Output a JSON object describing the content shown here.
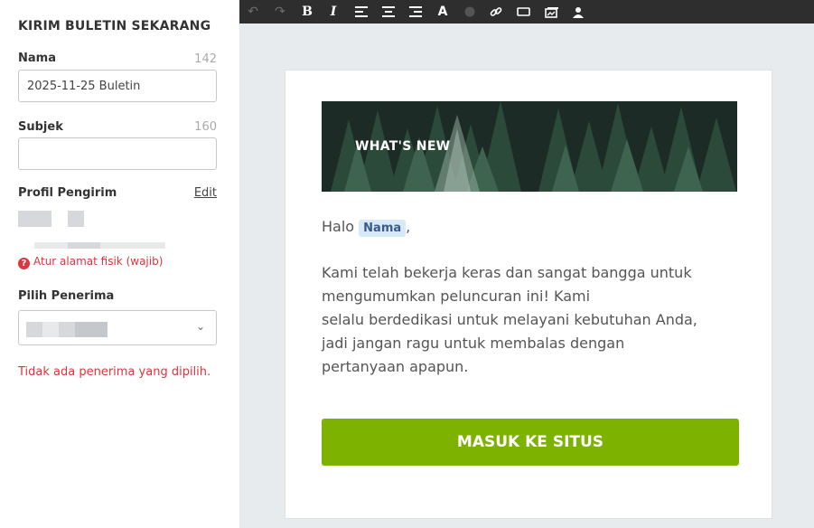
{
  "panel": {
    "title": "KIRIM BULETIN SEKARANG",
    "name_label": "Nama",
    "name_counter": "142",
    "name_value": "2025-11-25 Buletin",
    "subject_label": "Subjek",
    "subject_counter": "160",
    "subject_value": "",
    "sender_label": "Profil Pengirim",
    "edit_label": "Edit",
    "warning_text": "Atur alamat fisik (wajib)",
    "recipient_label": "Pilih Penerima",
    "recipient_error": "Tidak ada penerima yang dipilih."
  },
  "toolbar": {
    "buttons": [
      "undo",
      "redo",
      "bold",
      "italic",
      "align-left",
      "align-center",
      "align-right",
      "font-color",
      "circle",
      "link",
      "button",
      "image",
      "person"
    ]
  },
  "email": {
    "hero_text": "WHAT'S NEW",
    "greeting_prefix": "Halo",
    "greeting_token": "Nama",
    "greeting_suffix": ",",
    "body_lines": [
      "Kami telah bekerja keras dan sangat bangga untuk",
      "mengumumkan peluncuran ini! Kami",
      "selalu berdedikasi untuk melayani kebutuhan Anda,",
      "jadi jangan ragu untuk membalas dengan",
      "pertanyaan apapun."
    ],
    "cta_label": "MASUK KE SITUS"
  },
  "colors": {
    "accent_green": "#7db300",
    "error_red": "#d9363e",
    "toolbar_bg": "#2e2e2e",
    "editor_bg": "#e8ebee"
  }
}
